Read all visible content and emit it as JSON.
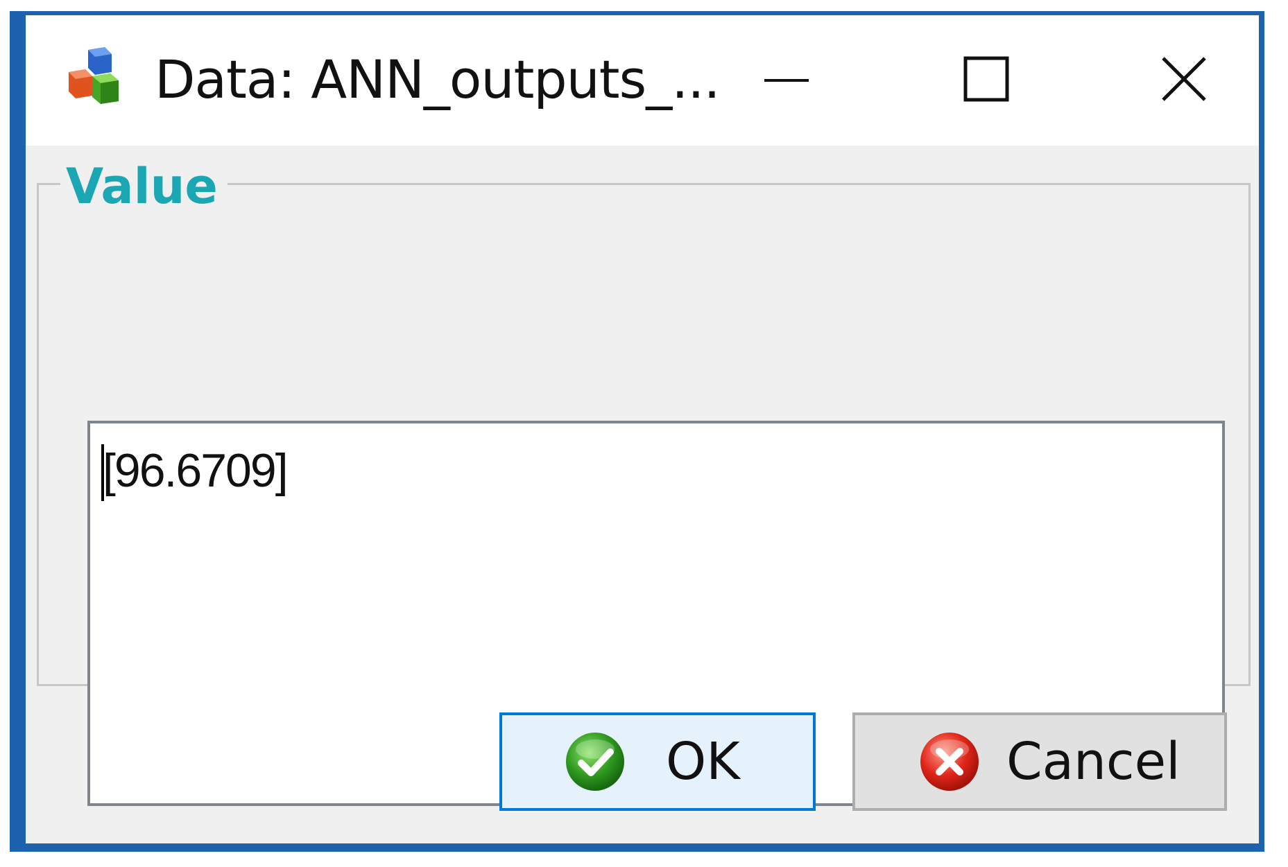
{
  "window": {
    "title": "Data: ANN_outputs_...",
    "icons": {
      "app": "data-cubes-icon",
      "minimize": "minimize-icon",
      "maximize": "maximize-icon",
      "close": "close-icon"
    }
  },
  "group": {
    "label": "Value"
  },
  "value_field": {
    "value": "[96.6709]"
  },
  "buttons": {
    "ok_label": "OK",
    "ok_icon": "check-circle-icon",
    "cancel_label": "Cancel",
    "cancel_icon": "cancel-circle-icon"
  },
  "colors": {
    "accent": "#0078d7",
    "group_label": "#1aa6b3",
    "desktop_edge": "#1d62ad"
  }
}
